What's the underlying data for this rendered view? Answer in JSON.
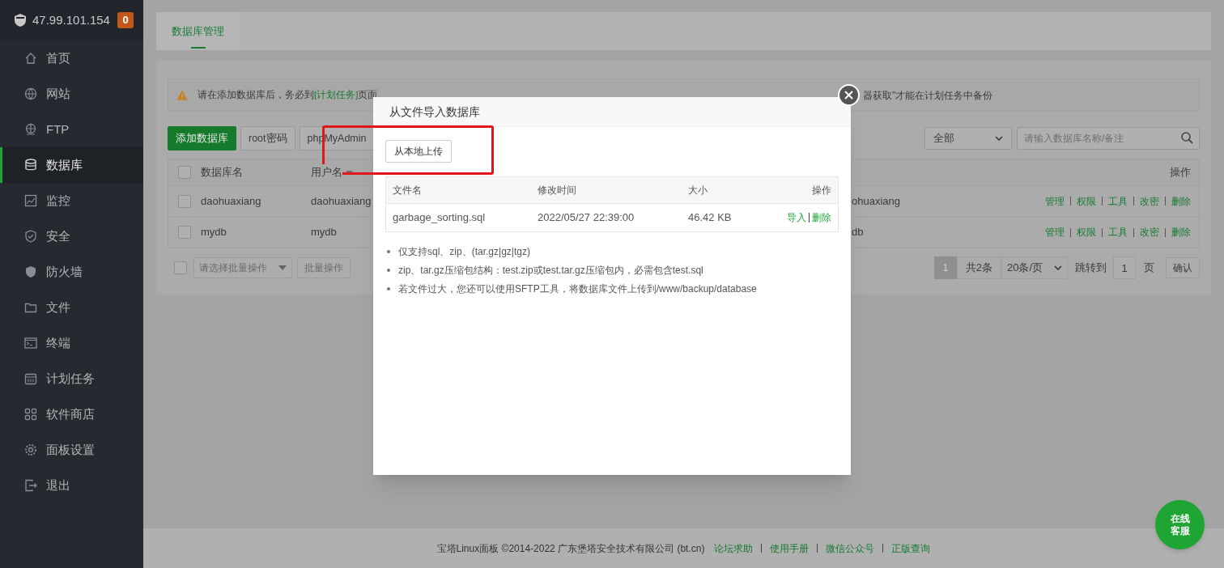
{
  "sidebar": {
    "host": "47.99.101.154",
    "badge": "0",
    "items": [
      {
        "label": "首页",
        "selected": false
      },
      {
        "label": "网站",
        "selected": false
      },
      {
        "label": "FTP",
        "selected": false
      },
      {
        "label": "数据库",
        "selected": true
      },
      {
        "label": "监控",
        "selected": false
      },
      {
        "label": "安全",
        "selected": false
      },
      {
        "label": "防火墙",
        "selected": false
      },
      {
        "label": "文件",
        "selected": false
      },
      {
        "label": "终端",
        "selected": false
      },
      {
        "label": "计划任务",
        "selected": false
      },
      {
        "label": "软件商店",
        "selected": false
      },
      {
        "label": "面板设置",
        "selected": false
      },
      {
        "label": "退出",
        "selected": false
      }
    ]
  },
  "tabs": [
    {
      "label": "数据库管理",
      "selected": true
    }
  ],
  "notice": {
    "prefix": "请在添加数据库后，务必到",
    "link": "[计划任务]",
    "suffix": "页面",
    "tail": "器获取\"才能在计划任务中备份"
  },
  "toolbar": {
    "buttons": [
      {
        "label": "添加数据库",
        "kind": "primary"
      },
      {
        "label": "root密码",
        "kind": "default"
      },
      {
        "label": "phpMyAdmin",
        "kind": "default"
      }
    ],
    "filter": "全部",
    "search_placeholder": "请输入数据库名称/备注"
  },
  "table": {
    "select_all": {
      "checked": false
    },
    "columns": [
      "数据库名",
      "用户名",
      "操作"
    ],
    "rows": [
      {
        "checked": false,
        "name": "daohuaxiang",
        "user": "daohuaxiang",
        "column_4": "ohuaxiang",
        "actions": [
          "管理",
          "权限",
          "工具",
          "改密",
          "删除"
        ]
      },
      {
        "checked": false,
        "name": "mydb",
        "user": "mydb",
        "column_4": "db",
        "actions": [
          "管理",
          "权限",
          "工具",
          "改密",
          "删除"
        ]
      }
    ]
  },
  "batch": {
    "checked": false,
    "placeholder": "请选择批量操作",
    "button": "批量操作"
  },
  "pagination": {
    "pages": [
      {
        "label": "1",
        "selected": true
      }
    ],
    "total": "共2条",
    "page_size": "20条/页",
    "goto": "跳转到",
    "goto_value": "1",
    "page_unit": "页",
    "confirm": "确认"
  },
  "modal": {
    "title": "从文件导入数据库",
    "upload": "从本地上传",
    "columns": [
      "文件名",
      "修改时间",
      "大小",
      "操作"
    ],
    "rows": [
      {
        "name": "garbage_sorting.sql",
        "time": "2022/05/27 22:39:00",
        "size": "46.42 KB",
        "actions": [
          "导入",
          "删除"
        ]
      }
    ],
    "notes": [
      "仅支持sql、zip、(tar.gz|gz|tgz)",
      "zip、tar.gz压缩包结构：test.zip或test.tar.gz压缩包内，必需包含test.sql",
      "若文件过大，您还可以使用SFTP工具，将数据库文件上传到/www/backup/database"
    ]
  },
  "footer": {
    "copyright": "宝塔Linux面板 ©2014-2022 广东堡塔安全技术有限公司 (bt.cn)",
    "links": [
      "论坛求助",
      "使用手册",
      "微信公众号",
      "正版查询"
    ]
  },
  "chat": {
    "lines": [
      "在线",
      "客服"
    ]
  }
}
